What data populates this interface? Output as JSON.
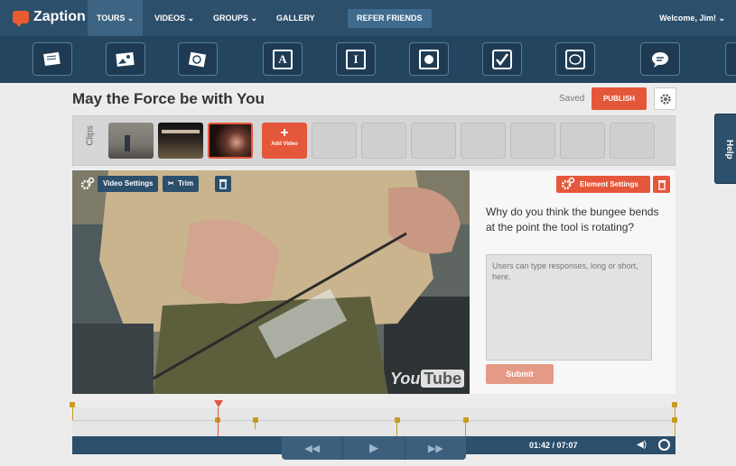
{
  "app": {
    "name": "Zaption"
  },
  "nav": {
    "items": [
      "TOURS",
      "VIDEOS",
      "GROUPS",
      "GALLERY"
    ],
    "refer": "REFER FRIENDS",
    "welcome": "Welcome, Jim!"
  },
  "toolbar": {
    "tools": [
      "text-card-icon",
      "image-icon",
      "drawing-icon",
      "answer-a-icon",
      "answer-i-icon",
      "radio-icon",
      "checkbox-icon",
      "discussion-icon",
      "comment-icon"
    ],
    "letter_a": "A",
    "letter_i": "I"
  },
  "help": "Help",
  "editor": {
    "title": "May the Force be with You",
    "status": "Saved",
    "publish": "PUBLISH"
  },
  "clips": {
    "label": "Clips",
    "add_video": "Add Video",
    "empty_slots": 7
  },
  "video": {
    "settings_label": "Video Settings",
    "trim_label": "Trim",
    "watermark_1": "You",
    "watermark_2": "Tube"
  },
  "element": {
    "settings_label": "Element Settings",
    "question": "Why do you think the bungee bends at the point the tool is rotating?",
    "response_placeholder": "Users can type responses, long or short, here.",
    "submit": "Submit"
  },
  "player": {
    "time": "01:42 / 07:07"
  },
  "colors": {
    "accent": "#e4573a",
    "nav": "#2c4f6c",
    "marker": "#c89c1e"
  }
}
